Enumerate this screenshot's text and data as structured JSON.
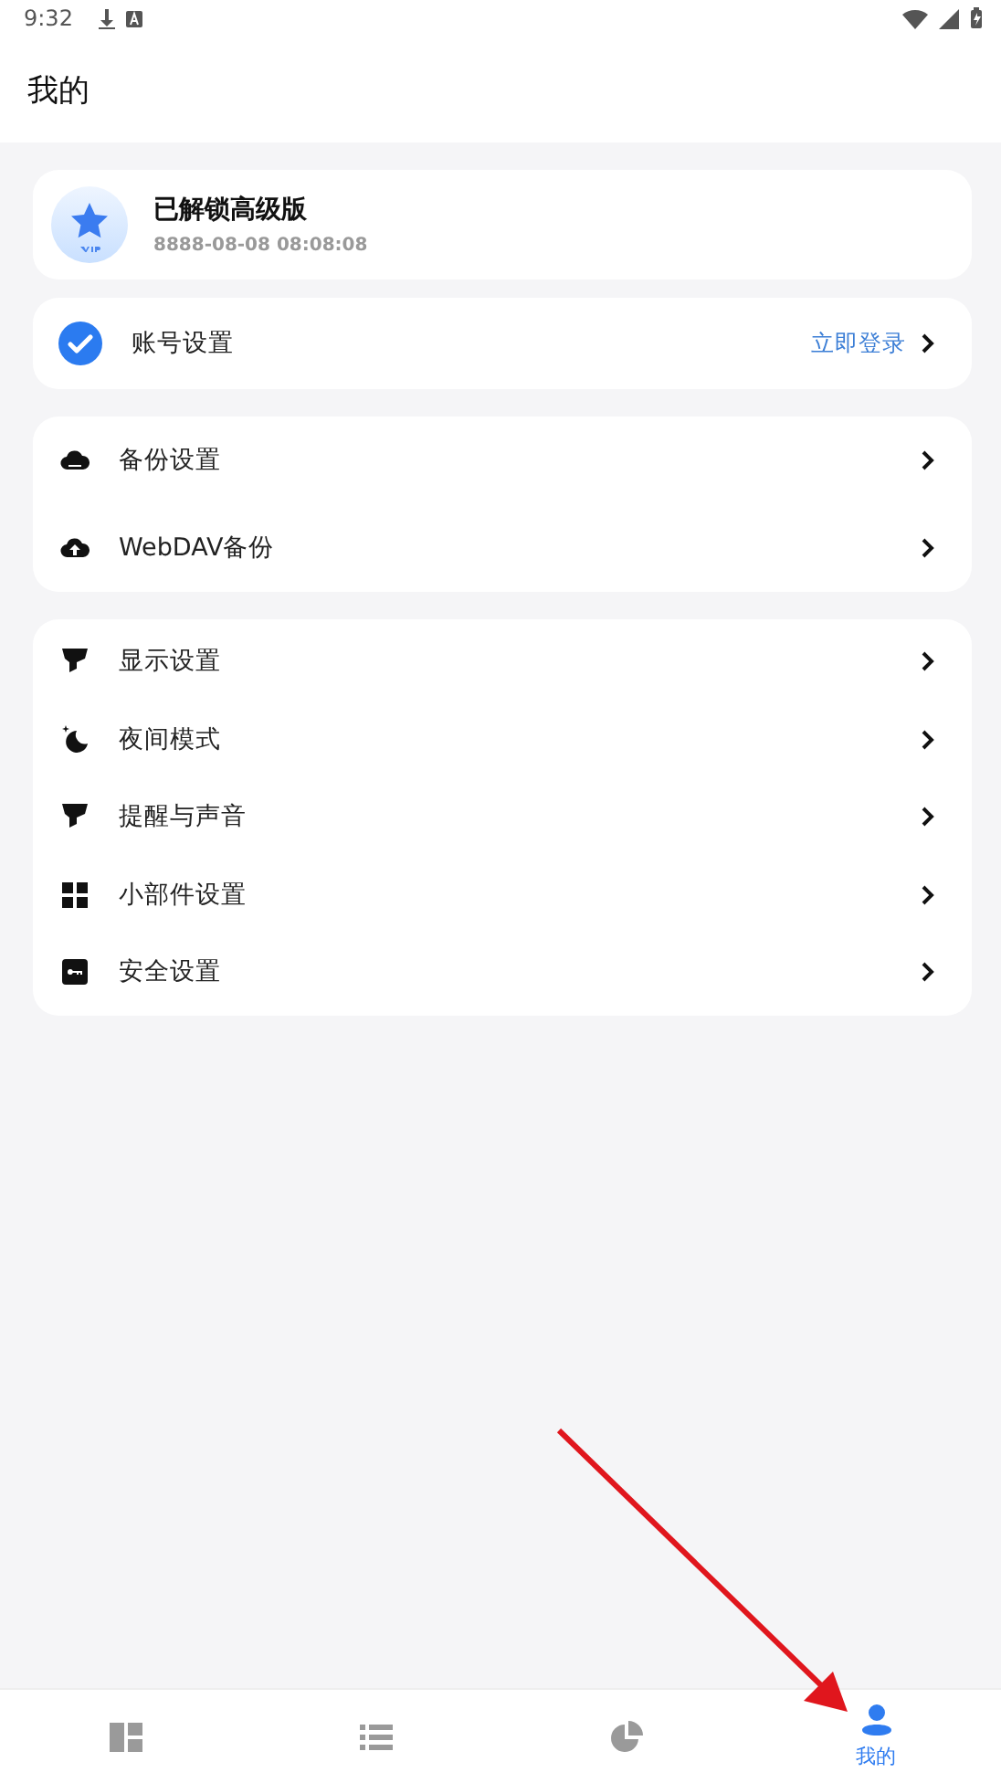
{
  "status_bar": {
    "time": "9:32"
  },
  "header": {
    "title": "我的"
  },
  "vip_card": {
    "title": "已解锁高级版",
    "date": "8888-08-08 08:08:08"
  },
  "account": {
    "label": "账号设置",
    "action": "立即登录"
  },
  "groups": [
    {
      "items": [
        {
          "kind": "cloud",
          "label": "备份设置"
        },
        {
          "kind": "upload",
          "label": "WebDAV备份"
        }
      ]
    },
    {
      "items": [
        {
          "kind": "funnel",
          "label": "显示设置"
        },
        {
          "kind": "moon",
          "label": "夜间模式"
        },
        {
          "kind": "funnel",
          "label": "提醒与声音"
        },
        {
          "kind": "grid",
          "label": "小部件设置"
        },
        {
          "kind": "key",
          "label": "安全设置"
        }
      ]
    }
  ],
  "bottom_nav": [
    {
      "kind": "dashboard",
      "selected": false
    },
    {
      "kind": "list",
      "selected": false
    },
    {
      "kind": "pie",
      "selected": false
    },
    {
      "kind": "person",
      "label": "我的",
      "selected": true
    }
  ]
}
